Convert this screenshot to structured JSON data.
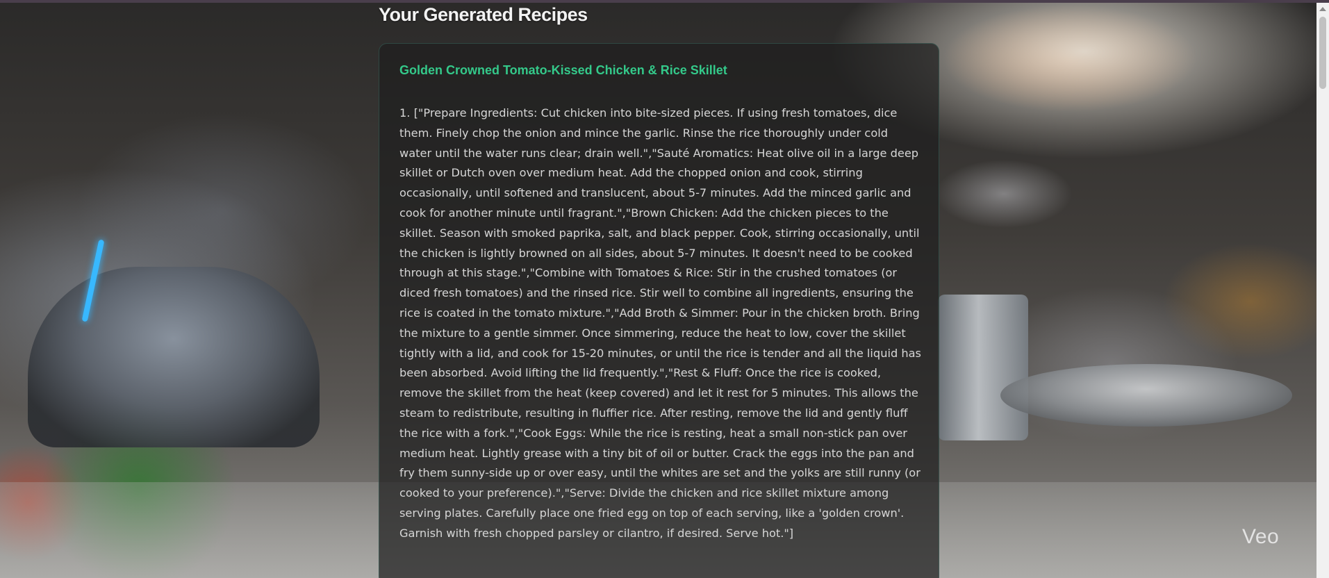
{
  "page": {
    "title": "Your Generated Recipes"
  },
  "background": {
    "watermark": "Veo"
  },
  "recipe": {
    "title": "Golden Crowned Tomato-Kissed Chicken & Rice Skillet",
    "steps_text": "1. [\"Prepare Ingredients: Cut chicken into bite-sized pieces. If using fresh tomatoes, dice them. Finely chop the onion and mince the garlic. Rinse the rice thoroughly under cold water until the water runs clear; drain well.\",\"Sauté Aromatics: Heat olive oil in a large deep skillet or Dutch oven over medium heat. Add the chopped onion and cook, stirring occasionally, until softened and translucent, about 5-7 minutes. Add the minced garlic and cook for another minute until fragrant.\",\"Brown Chicken: Add the chicken pieces to the skillet. Season with smoked paprika, salt, and black pepper. Cook, stirring occasionally, until the chicken is lightly browned on all sides, about 5-7 minutes. It doesn't need to be cooked through at this stage.\",\"Combine with Tomatoes & Rice: Stir in the crushed tomatoes (or diced fresh tomatoes) and the rinsed rice. Stir well to combine all ingredients, ensuring the rice is coated in the tomato mixture.\",\"Add Broth & Simmer: Pour in the chicken broth. Bring the mixture to a gentle simmer. Once simmering, reduce the heat to low, cover the skillet tightly with a lid, and cook for 15-20 minutes, or until the rice is tender and all the liquid has been absorbed. Avoid lifting the lid frequently.\",\"Rest & Fluff: Once the rice is cooked, remove the skillet from the heat (keep covered) and let it rest for 5 minutes. This allows the steam to redistribute, resulting in fluffier rice. After resting, remove the lid and gently fluff the rice with a fork.\",\"Cook Eggs: While the rice is resting, heat a small non-stick pan over medium heat. Lightly grease with a tiny bit of oil or butter. Crack the eggs into the pan and fry them sunny-side up or over easy, until the whites are set and the yolks are still runny (or cooked to your preference).\",\"Serve: Divide the chicken and rice skillet mixture among serving plates. Carefully place one fried egg on top of each serving, like a 'golden crown'. Garnish with fresh chopped parsley or cilantro, if desired. Serve hot.\"]"
  },
  "colors": {
    "accent": "#34c98a",
    "card_bg": "#1e1e1e",
    "text": "#d6d6d6"
  }
}
